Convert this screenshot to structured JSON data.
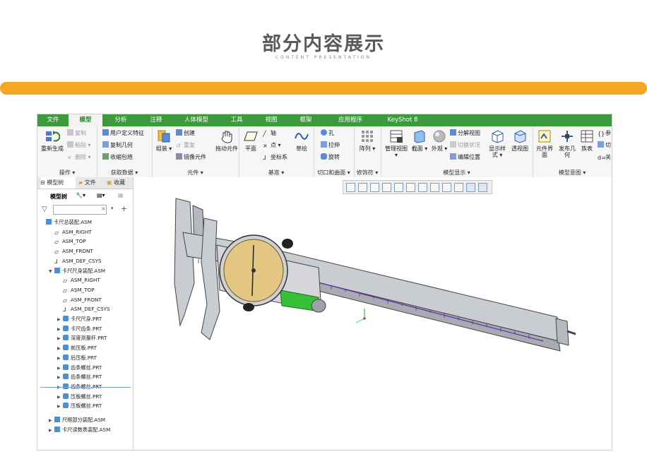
{
  "header": {
    "title": "部分内容展示",
    "subtitle": "CONTENT PRESENTATION"
  },
  "colors": {
    "accent_orange": "#f5a623",
    "ribbon_green": "#3c9a3c"
  },
  "tabs": [
    "文件",
    "模型",
    "分析",
    "注释",
    "人体模型",
    "工具",
    "视图",
    "框架",
    "应用程序",
    "KeyShot 8"
  ],
  "active_tab": "模型",
  "ribbon": {
    "groups": {
      "operation": "操作",
      "get_data": "获取数据",
      "component": "元件",
      "datum": "基准",
      "cut_surface": "切口和曲面",
      "modifier": "修饰符",
      "model_display": "模型显示",
      "model_intent": "模型意图"
    },
    "regenerate": "重新生成",
    "copy": "复制",
    "paste": "粘贴",
    "delete": "删除",
    "user_feature": "用户定义特征",
    "copy_geometry": "复制几何",
    "shrinkwrap": "收缩包络",
    "assemble": "组装",
    "create": "创建",
    "repeat": "重复",
    "mirror_component": "镜像元件",
    "drag_component": "拖动元件",
    "plane": "平面",
    "axis": "轴",
    "point": "点",
    "coord_sys": "坐标系",
    "sketch": "草绘",
    "hole": "孔",
    "extrude": "拉伸",
    "revolve": "旋转",
    "pattern": "阵列",
    "manage_views": "管理视图",
    "section": "截面",
    "appearance": "外观",
    "explode_view": "分解视图",
    "toggle_state": "切换状况",
    "edit_position": "编辑位置",
    "display_style": "显示样式",
    "perspective": "透视图",
    "component_interface": "元件界面",
    "publish_geometry": "发布几何",
    "family_table": "族表",
    "params": "参",
    "switch": "切",
    "relations": "关"
  },
  "left_panel": {
    "tabs": [
      "模型树",
      "文件",
      "收藏"
    ],
    "tree_label": "模型树",
    "filter_placeholder": "",
    "tree": [
      {
        "label": "卡尺总装配.ASM",
        "icon": "assembly-icon",
        "level": 0,
        "arrow": ""
      },
      {
        "label": "ASM_RIGHT",
        "icon": "datum-plane-icon",
        "level": 1,
        "arrow": ""
      },
      {
        "label": "ASM_TOP",
        "icon": "datum-plane-icon",
        "level": 1,
        "arrow": ""
      },
      {
        "label": "ASM_FRONT",
        "icon": "datum-plane-icon",
        "level": 1,
        "arrow": ""
      },
      {
        "label": "ASM_DEF_CSYS",
        "icon": "csys-icon",
        "level": 1,
        "arrow": ""
      },
      {
        "label": "卡尺尺身装配.ASM",
        "icon": "assembly-icon",
        "level": 1,
        "arrow": "▼"
      },
      {
        "label": "ASM_RIGHT",
        "icon": "datum-plane-icon",
        "level": 2,
        "arrow": ""
      },
      {
        "label": "ASM_TOP",
        "icon": "datum-plane-icon",
        "level": 2,
        "arrow": ""
      },
      {
        "label": "ASM_FRONT",
        "icon": "datum-plane-icon",
        "level": 2,
        "arrow": ""
      },
      {
        "label": "ASM_DEF_CSYS",
        "icon": "csys-icon",
        "level": 2,
        "arrow": ""
      },
      {
        "label": "卡尺尺身.PRT",
        "icon": "part-icon",
        "level": 2,
        "arrow": "▶"
      },
      {
        "label": "卡尺齿条.PRT",
        "icon": "part-icon",
        "level": 2,
        "arrow": "▶"
      },
      {
        "label": "深度测量杆.PRT",
        "icon": "part-icon",
        "level": 2,
        "arrow": "▶"
      },
      {
        "label": "前压板.PRT",
        "icon": "part-icon",
        "level": 2,
        "arrow": "▶"
      },
      {
        "label": "后压板.PRT",
        "icon": "part-icon",
        "level": 2,
        "arrow": "▶"
      },
      {
        "label": "齿条螺丝.PRT",
        "icon": "part-icon",
        "level": 2,
        "arrow": "▶"
      },
      {
        "label": "齿条螺丝.PRT",
        "icon": "part-icon",
        "level": 2,
        "arrow": "▶"
      },
      {
        "label": "齿条螺丝.PRT",
        "icon": "part-icon",
        "level": 2,
        "arrow": "▶"
      },
      {
        "label": "压板螺丝.PRT",
        "icon": "part-icon",
        "level": 2,
        "arrow": "▶"
      },
      {
        "label": "压板螺丝.PRT",
        "icon": "part-icon",
        "level": 2,
        "arrow": "▶"
      },
      {
        "label": "尺框部分装配.ASM",
        "icon": "assembly-icon",
        "level": 1,
        "arrow": "▶"
      },
      {
        "label": "卡尺读数表装配.ASM",
        "icon": "assembly-icon",
        "level": 1,
        "arrow": "▶"
      }
    ]
  },
  "view_toolbar": [
    "zoom-fit-icon",
    "zoom-in-icon",
    "zoom-out-icon",
    "reorient-icon",
    "view-manager-icon",
    "display-style-icon",
    "saved-views-icon",
    "section-view-icon",
    "spin-center-icon",
    "datum-display-icon",
    "annotation-display-icon",
    "more-icon"
  ]
}
